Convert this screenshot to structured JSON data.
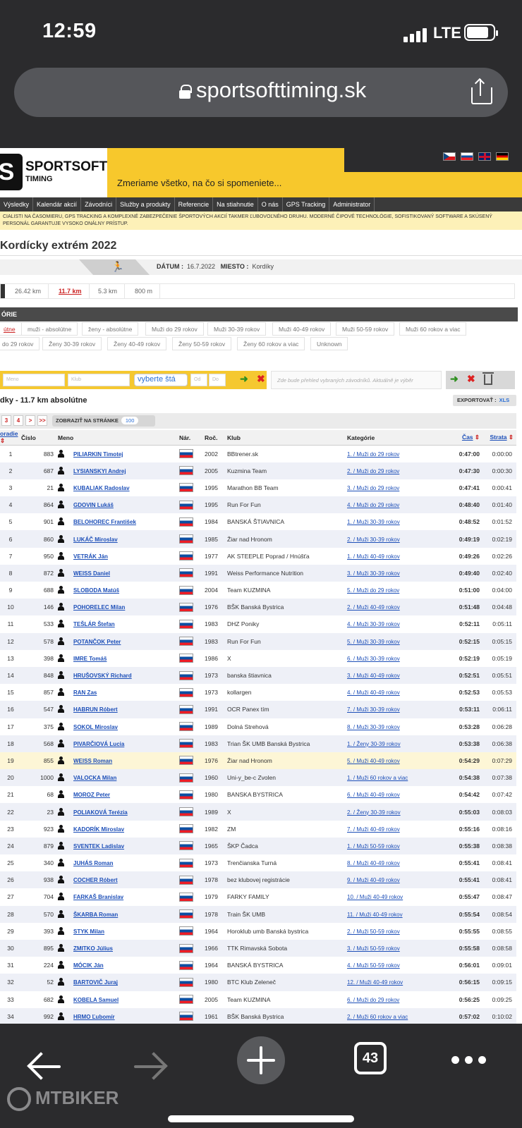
{
  "status": {
    "time": "12:59",
    "network": "LTE"
  },
  "browser": {
    "url": "sportsofttiming.sk",
    "tab_count": "43"
  },
  "site": {
    "logo_mark": "S",
    "logo_name": "SPORTSOFT",
    "logo_sub": "TIMING",
    "slogan": "Zmeriame všetko, na čo si spomeniete...",
    "nav": [
      "Výsledky",
      "Kalendár akcií",
      "Závodníci",
      "Služby a produkty",
      "Referencie",
      "Na stiahnutie",
      "O nás",
      "GPS Tracking",
      "Administrator"
    ],
    "tagline": "cialisti na časomieru, GPS tracking a komplexné zabezpečenie športových akcií takmer ľubovoľného druhu. Moderné čipové technológie, sofistikovaný software a skúsený personál garantuje vysoko onálny prístup."
  },
  "race": {
    "title": "Kordícky extrém 2022",
    "date_label": "DÁTUM :",
    "date": "16.7.2022",
    "place_label": "MIESTO :",
    "place": "Kordíky"
  },
  "distances": [
    "26.42 km",
    "11.7 km",
    "5.3 km",
    "800 m"
  ],
  "categories_header": "ÓRIE",
  "categories_row1": [
    "útne",
    "muži - absolútne",
    "ženy - absolútne",
    "Muži do 29 rokov",
    "Muži 30-39 rokov",
    "Muži 40-49 rokov",
    "Muži 50-59 rokov",
    "Muži 60 rokov a viac"
  ],
  "categories_row2": [
    "do 29 rokov",
    "Ženy 30-39 rokov",
    "Ženy 40-49 rokov",
    "Ženy 50-59 rokov",
    "Ženy 60 rokov a viac",
    "Unknown"
  ],
  "filter": {
    "name_placeholder": "Meno",
    "club_placeholder": "Klub",
    "state_select": "vyberte štá",
    "from_placeholder": "Od",
    "to_placeholder": "Do",
    "compare_hint": "Zde bude přehled vybraných závodníků. Aktuálně je výběr"
  },
  "results_title": "dky - 11.7 km absolútne",
  "export": {
    "label": "EXPORTOVAŤ :",
    "xls": "XLS"
  },
  "pager": {
    "pages": [
      "3",
      "4",
      ">",
      ">>"
    ],
    "per_page_label": "ZOBRAZIŤ NA STRÁNKE",
    "per_page_value": "100"
  },
  "table": {
    "headers": {
      "rank": "oradie",
      "number": "Číslo",
      "name": "Meno",
      "nat": "Nár.",
      "year": "Roč.",
      "club": "Klub",
      "category": "Kategórie",
      "time": "Čas",
      "loss": "Strata"
    },
    "rows": [
      [
        "1",
        "883",
        "PILIARKIN Timotej",
        "2002",
        "BBtrener.sk",
        "1. / Muži do 29 rokov",
        "0:47:00",
        "0:00:00"
      ],
      [
        "2",
        "687",
        "LYSIANSKYI Andrej",
        "2005",
        "Kuzmina Team",
        "2. / Muži do 29 rokov",
        "0:47:30",
        "0:00:30"
      ],
      [
        "3",
        "21",
        "KUBALIAK Radoslav",
        "1995",
        "Marathon BB Team",
        "3. / Muži do 29 rokov",
        "0:47:41",
        "0:00:41"
      ],
      [
        "4",
        "864",
        "GDOVIN Lukáš",
        "1995",
        "Run For Fun",
        "4. / Muži do 29 rokov",
        "0:48:40",
        "0:01:40"
      ],
      [
        "5",
        "901",
        "BELOHOREC František",
        "1984",
        "BANSKÁ ŠTIAVNICA",
        "1. / Muži 30-39 rokov",
        "0:48:52",
        "0:01:52"
      ],
      [
        "6",
        "860",
        "LUKÁČ Miroslav",
        "1985",
        "Žiar nad Hronom",
        "2. / Muži 30-39 rokov",
        "0:49:19",
        "0:02:19"
      ],
      [
        "7",
        "950",
        "VETRÁK Ján",
        "1977",
        "AK STEEPLE Poprad / Hnúšťa",
        "1. / Muži 40-49 rokov",
        "0:49:26",
        "0:02:26"
      ],
      [
        "8",
        "872",
        "WEISS Daniel",
        "1991",
        "Weiss Performance Nutrition",
        "3. / Muži 30-39 rokov",
        "0:49:40",
        "0:02:40"
      ],
      [
        "9",
        "688",
        "SLOBODA Matúš",
        "2004",
        "Team KUZMINA",
        "5. / Muži do 29 rokov",
        "0:51:00",
        "0:04:00"
      ],
      [
        "10",
        "146",
        "POHORELEC Milan",
        "1976",
        "BŠK Banská Bystrica",
        "2. / Muži 40-49 rokov",
        "0:51:48",
        "0:04:48"
      ],
      [
        "11",
        "533",
        "TEŠLÁR Štefan",
        "1983",
        "DHZ Poniky",
        "4. / Muži 30-39 rokov",
        "0:52:11",
        "0:05:11"
      ],
      [
        "12",
        "578",
        "POTANČOK Peter",
        "1983",
        "Run For Fun",
        "5. / Muži 30-39 rokov",
        "0:52:15",
        "0:05:15"
      ],
      [
        "13",
        "398",
        "IMRE Tomáš",
        "1986",
        "X",
        "6. / Muži 30-39 rokov",
        "0:52:19",
        "0:05:19"
      ],
      [
        "14",
        "848",
        "HRUŠOVSKÝ Richard",
        "1973",
        "banska štiavnica",
        "3. / Muži 40-49 rokov",
        "0:52:51",
        "0:05:51"
      ],
      [
        "15",
        "857",
        "RAN Zas",
        "1973",
        "kollargen",
        "4. / Muži 40-49 rokov",
        "0:52:53",
        "0:05:53"
      ],
      [
        "16",
        "547",
        "HABRUN Róbert",
        "1991",
        "OCR Panex tím",
        "7. / Muži 30-39 rokov",
        "0:53:11",
        "0:06:11"
      ],
      [
        "17",
        "375",
        "SOKOL Miroslav",
        "1989",
        "Dolná Strehová",
        "8. / Muži 30-39 rokov",
        "0:53:28",
        "0:06:28"
      ],
      [
        "18",
        "568",
        "PIVARČIOVÁ Lucia",
        "1983",
        "Trian ŠK UMB Banská Bystrica",
        "1. / Ženy 30-39 rokov",
        "0:53:38",
        "0:06:38"
      ],
      [
        "19",
        "855",
        "WEISS Roman",
        "1976",
        "Žiar nad Hronom",
        "5. / Muži 40-49 rokov",
        "0:54:29",
        "0:07:29"
      ],
      [
        "20",
        "1000",
        "VALOCKA Milan",
        "1960",
        "Uni-y_be-c Zvolen",
        "1. / Muži 60 rokov a viac",
        "0:54:38",
        "0:07:38"
      ],
      [
        "21",
        "68",
        "MOROZ Peter",
        "1980",
        "BANSKA BYSTRICA",
        "6. / Muži 40-49 rokov",
        "0:54:42",
        "0:07:42"
      ],
      [
        "22",
        "23",
        "POLIAKOVÁ Terézia",
        "1989",
        "X",
        "2. / Ženy 30-39 rokov",
        "0:55:03",
        "0:08:03"
      ],
      [
        "23",
        "923",
        "KADORÍK Miroslav",
        "1982",
        "ZM",
        "7. / Muži 40-49 rokov",
        "0:55:16",
        "0:08:16"
      ],
      [
        "24",
        "879",
        "SVENTEK Ladislav",
        "1965",
        "ŠKP Čadca",
        "1. / Muži 50-59 rokov",
        "0:55:38",
        "0:08:38"
      ],
      [
        "25",
        "340",
        "JUHÁS Roman",
        "1973",
        "Trenčianska Turná",
        "8. / Muži 40-49 rokov",
        "0:55:41",
        "0:08:41"
      ],
      [
        "26",
        "938",
        "COCHER Róbert",
        "1978",
        "bez klubovej registrácie",
        "9. / Muži 40-49 rokov",
        "0:55:41",
        "0:08:41"
      ],
      [
        "27",
        "704",
        "FARKAŠ Branislav",
        "1979",
        "FARKY FAMILY",
        "10. / Muži 40-49 rokov",
        "0:55:47",
        "0:08:47"
      ],
      [
        "28",
        "570",
        "ŠKARBA Roman",
        "1978",
        "Train ŠK UMB",
        "11. / Muži 40-49 rokov",
        "0:55:54",
        "0:08:54"
      ],
      [
        "29",
        "393",
        "STYK Milan",
        "1964",
        "Horoklub umb Banská bystrica",
        "2. / Muži 50-59 rokov",
        "0:55:55",
        "0:08:55"
      ],
      [
        "30",
        "895",
        "ZMITKO Július",
        "1966",
        "TTK Rimavská Sobota",
        "3. / Muži 50-59 rokov",
        "0:55:58",
        "0:08:58"
      ],
      [
        "31",
        "224",
        "MÓCIK Ján",
        "1964",
        "BANSKÁ BYSTRICA",
        "4. / Muži 50-59 rokov",
        "0:56:01",
        "0:09:01"
      ],
      [
        "32",
        "52",
        "BARTOVIČ Juraj",
        "1980",
        "BTC Klub Zeleneč",
        "12. / Muži 40-49 rokov",
        "0:56:15",
        "0:09:15"
      ],
      [
        "33",
        "682",
        "KOBELA Samuel",
        "2005",
        "Team KUZMINA",
        "6. / Muži do 29 rokov",
        "0:56:25",
        "0:09:25"
      ],
      [
        "34",
        "992",
        "HRMO Ľubomír",
        "1961",
        "BŠK Banská Bystrica",
        "2. / Muži 60 rokov a viac",
        "0:57:02",
        "0:10:02"
      ]
    ],
    "highlighted_rank": "19"
  },
  "watermark": "MTBIKER"
}
